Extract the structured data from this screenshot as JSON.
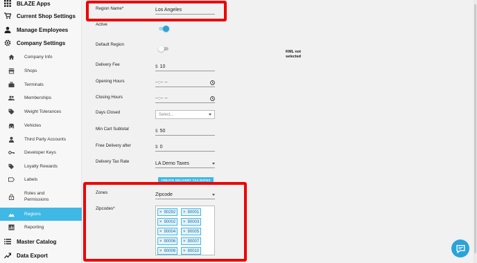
{
  "sidebar": {
    "top": [
      {
        "label": "BLAZE Apps",
        "icon": "grid-icon"
      },
      {
        "label": "Current Shop Settings",
        "icon": "cart-icon"
      },
      {
        "label": "Manage Employees",
        "icon": "person-icon"
      },
      {
        "label": "Company Settings",
        "icon": "gear-icon"
      }
    ],
    "sub": [
      {
        "label": "Company Info",
        "icon": "home-icon"
      },
      {
        "label": "Shops",
        "icon": "store-icon"
      },
      {
        "label": "Terminals",
        "icon": "briefcase-icon"
      },
      {
        "label": "Memberships",
        "icon": "people-icon"
      },
      {
        "label": "Weight Tolerances",
        "icon": "tag-icon"
      },
      {
        "label": "Vehicles",
        "icon": "car-icon"
      },
      {
        "label": "Third Party Accounts",
        "icon": "person-icon"
      },
      {
        "label": "Developer Keys",
        "icon": "key-icon"
      },
      {
        "label": "Loyalty Rewards",
        "icon": "tags-icon"
      },
      {
        "label": "Labels",
        "icon": "label-icon"
      },
      {
        "label": "Roles and Permissions",
        "icon": "lock-icon"
      },
      {
        "label": "Regions",
        "icon": "terrain-icon"
      },
      {
        "label": "Reporting",
        "icon": "chart-icon"
      }
    ],
    "bottom": [
      {
        "label": "Master Catalog",
        "icon": "list-icon"
      },
      {
        "label": "Data Export",
        "icon": "trend-icon"
      }
    ]
  },
  "form": {
    "region_name_label": "Region Name*",
    "region_name_value": "Los Angeles",
    "active_label": "Active",
    "active_on": true,
    "default_region_label": "Default Region",
    "default_region_on": false,
    "delivery_fee_label": "Delivery Fee",
    "delivery_fee_prefix": "$",
    "delivery_fee_value": "10",
    "opening_hours_label": "Opening Hours",
    "opening_hours_value": "--:-- --",
    "closing_hours_label": "Closing Hours",
    "closing_hours_value": "--:-- --",
    "days_closed_label": "Days Closed",
    "days_closed_placeholder": "Select...",
    "min_cart_label": "Min Cart Subtotal",
    "min_cart_prefix": "$",
    "min_cart_value": "50",
    "free_delivery_label": "Free Delivery after",
    "free_delivery_prefix": "$",
    "free_delivery_value": "0",
    "tax_rate_label": "Delivery Tax Rate",
    "tax_rate_value": "LA Demo Taxes",
    "tax_button_label": "CREATE DELIVERY TAX RATES",
    "zones_label": "Zones",
    "zones_value": "Zipcode",
    "zipcodes_label": "Zipcodes*",
    "zipcodes": [
      "90292",
      "90001",
      "90002",
      "90003",
      "90004",
      "90005",
      "90006",
      "90007",
      "90008",
      "90010"
    ],
    "chip_remove": "×"
  },
  "kml": {
    "line1": "KML not",
    "line2": "selected"
  },
  "colors": {
    "accent": "#3fb8e6",
    "highlight": "#e00000"
  }
}
